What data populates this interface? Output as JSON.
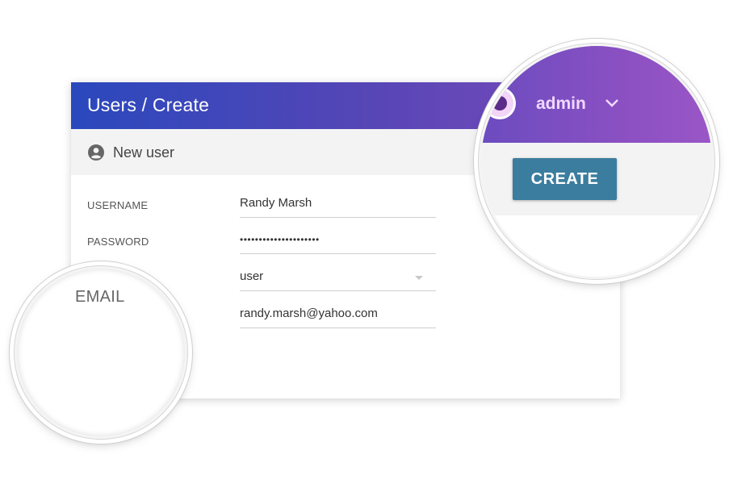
{
  "header": {
    "breadcrumb": "Users / Create",
    "username": "admin"
  },
  "subheader": {
    "title": "New user",
    "icon": "user-circle-icon"
  },
  "form": {
    "username": {
      "label": "USERNAME",
      "value": "Randy Marsh"
    },
    "password": {
      "label": "PASSWORD",
      "value": "•••••••••••••••••••••"
    },
    "role": {
      "value": "user"
    },
    "email": {
      "label": "EMAIL",
      "value": "randy.marsh@yahoo.com"
    }
  },
  "actions": {
    "create_label": "CREATE"
  },
  "colors": {
    "header_start": "#2a48bd",
    "header_end": "#7e4bbd",
    "button": "#3b7d9f"
  }
}
